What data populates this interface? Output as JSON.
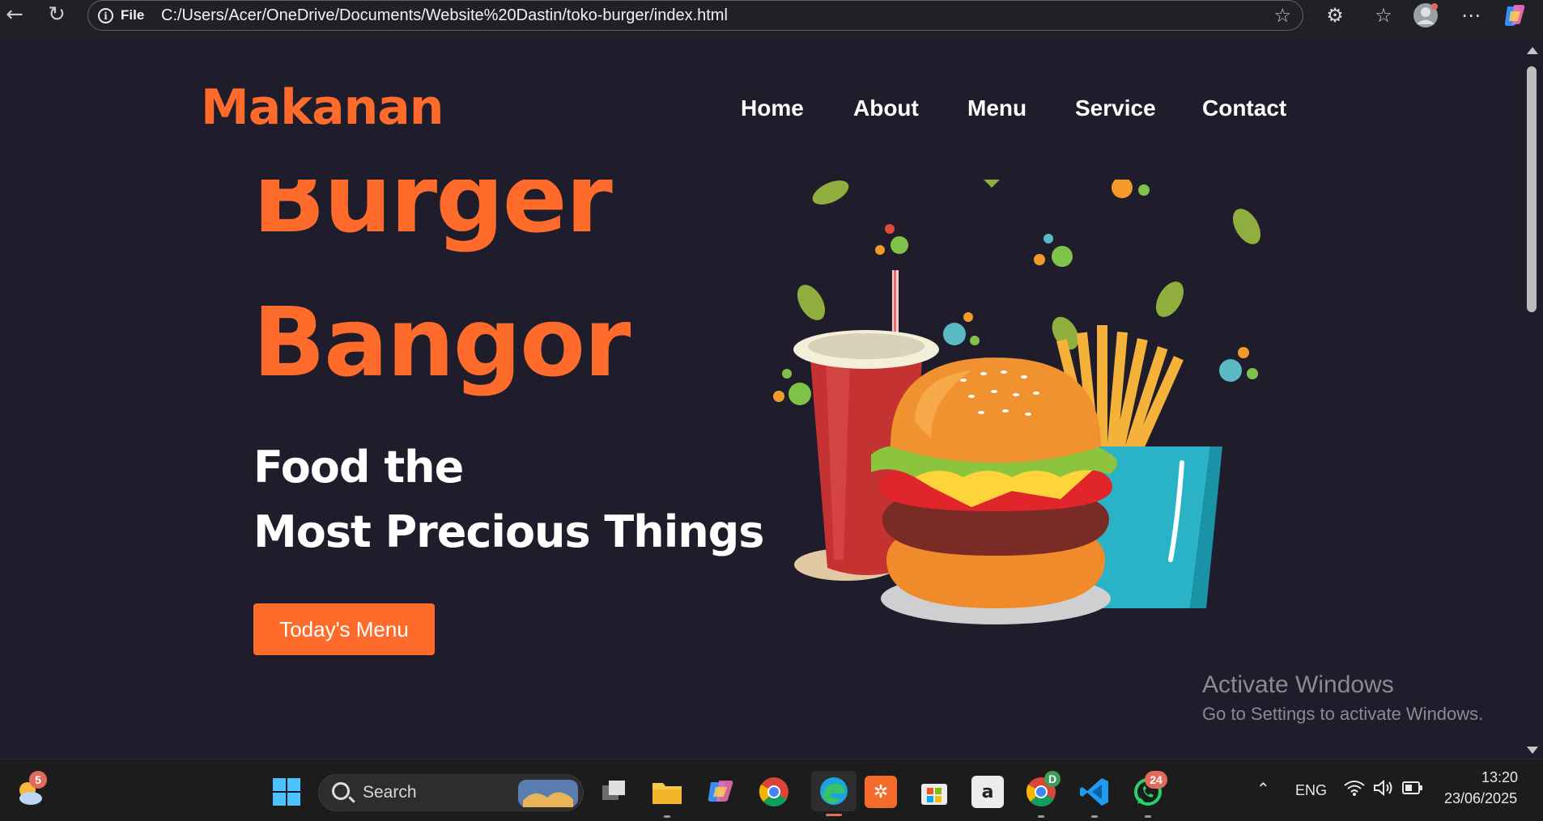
{
  "browser": {
    "file_label": "File",
    "url": "C:/Users/Acer/OneDrive/Documents/Website%20Dastin/toko-burger/index.html"
  },
  "site": {
    "brand": "Makanan",
    "nav": [
      "Home",
      "About",
      "Menu",
      "Service",
      "Contact"
    ],
    "hero": {
      "line1": "Burger",
      "line2": "Bangor",
      "sub1": "Food the",
      "sub2": "Most Precious Things",
      "cta": "Today's Menu"
    },
    "accent_color": "#ff6b2b",
    "background_color": "#1f1d2b"
  },
  "watermark": {
    "title": "Activate Windows",
    "subtitle": "Go to Settings to activate Windows."
  },
  "taskbar": {
    "weather_badge": "5",
    "search_placeholder": "Search",
    "whatsapp_badge": "24",
    "chrome_profile_letter": "D",
    "language": "ENG",
    "time": "13:20",
    "date": "23/06/2025"
  }
}
